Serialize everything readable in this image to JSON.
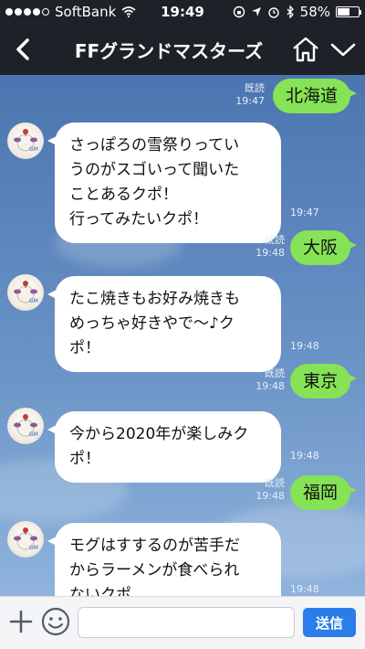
{
  "status_bar": {
    "carrier": "SoftBank",
    "time": "19:49",
    "battery_text": "58%",
    "battery_level": 0.58,
    "signal_bars_filled": 4,
    "signal_bars_total": 5
  },
  "nav": {
    "title": "FFグランドマスターズ",
    "icons": [
      "back-chevron-icon",
      "home-icon",
      "chevron-down-icon"
    ]
  },
  "messages": [
    {
      "type": "out",
      "text": "北海道",
      "read": "既読",
      "time": "19:47"
    },
    {
      "type": "in",
      "text": "さっぽろの雪祭りってい\nうのがスゴいって聞いた\nことあるクポ！\n行ってみたいクポ！",
      "time": "19:47"
    },
    {
      "type": "out",
      "text": "大阪",
      "read": "既読",
      "time": "19:48"
    },
    {
      "type": "in",
      "text": "たこ焼きもお好み焼きも\nめっちゃ好きやで〜♪ク\nポ！",
      "time": "19:48"
    },
    {
      "type": "out",
      "text": "東京",
      "read": "既読",
      "time": "19:48"
    },
    {
      "type": "in",
      "text": "今から2020年が楽しみク\nポ！",
      "time": "19:48"
    },
    {
      "type": "out",
      "text": "福岡",
      "read": "既読",
      "time": "19:48"
    },
    {
      "type": "in",
      "text": "モグはすするのが苦手だ\nからラーメンが食べられ\nないクポ…",
      "time": "19:48"
    }
  ],
  "input_bar": {
    "input_value": "",
    "send_label": "送信",
    "icons": [
      "plus-icon",
      "emoji-icon"
    ]
  },
  "colors": {
    "header_bg": "#1f2128",
    "outgoing_bubble": "#86e256",
    "incoming_bubble": "#ffffff",
    "send_button": "#2b7de9"
  }
}
